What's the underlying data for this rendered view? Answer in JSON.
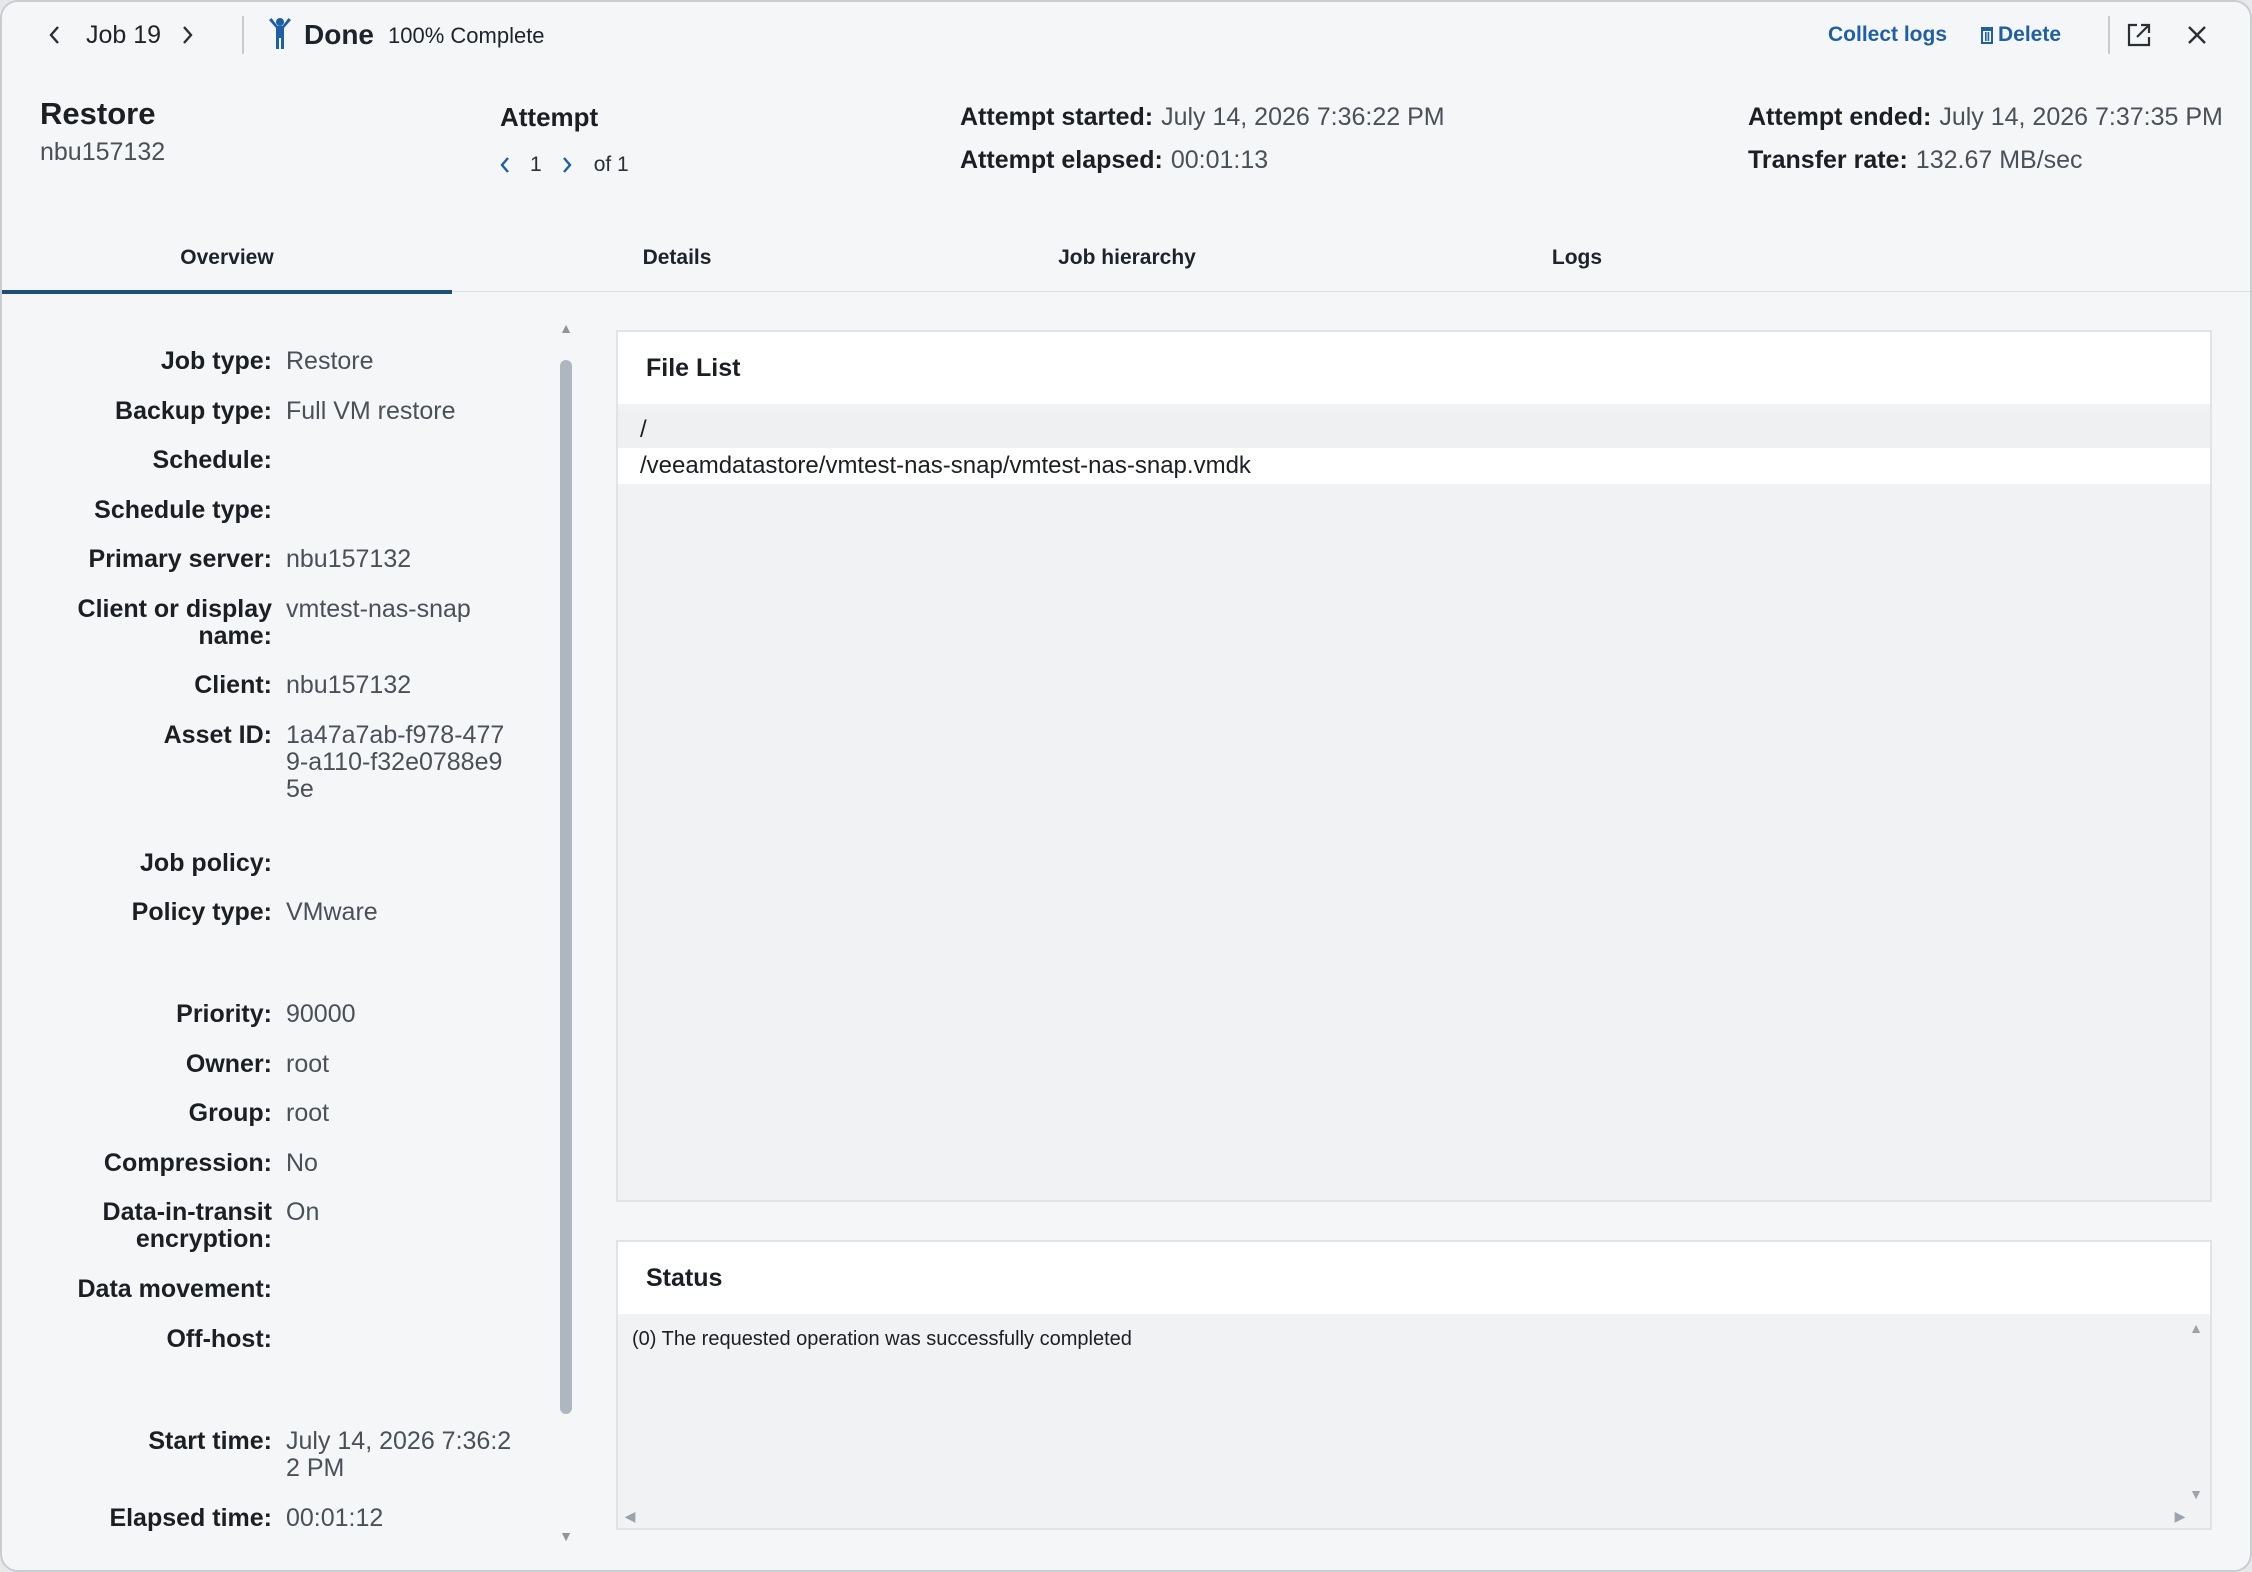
{
  "topbar": {
    "job_label": "Job 19",
    "status_label": "Done",
    "complete_label": "100% Complete",
    "collect_logs": "Collect logs",
    "delete": "Delete"
  },
  "header": {
    "title": "Restore",
    "subtitle": "nbu157132",
    "attempt_title": "Attempt",
    "attempt_current": "1",
    "attempt_of": "of 1",
    "attempt_started_label": "Attempt started:",
    "attempt_started_value": "July 14, 2026 7:36:22 PM",
    "attempt_elapsed_label": "Attempt elapsed:",
    "attempt_elapsed_value": "00:01:13",
    "attempt_ended_label": "Attempt ended:",
    "attempt_ended_value": "July 14, 2026 7:37:35 PM",
    "transfer_rate_label": "Transfer rate:",
    "transfer_rate_value": "132.67 MB/sec"
  },
  "tabs": [
    "Overview",
    "Details",
    "Job hierarchy",
    "Logs"
  ],
  "fields": [
    {
      "label": "Job type:",
      "value": "Restore"
    },
    {
      "label": "Backup type:",
      "value": "Full VM restore"
    },
    {
      "label": "Schedule:",
      "value": ""
    },
    {
      "label": "Schedule type:",
      "value": ""
    },
    {
      "label": "Primary server:",
      "value": "nbu157132"
    },
    {
      "label": "Client or display name:",
      "value": "vmtest-nas-snap"
    },
    {
      "label": "Client:",
      "value": "nbu157132"
    },
    {
      "label": "Asset ID:",
      "value": "1a47a7ab-f978-4779-a110-f32e0788e95e"
    },
    {
      "label": "Job policy:",
      "value": ""
    },
    {
      "label": "Policy type:",
      "value": "VMware"
    },
    {
      "label": "Priority:",
      "value": "90000"
    },
    {
      "label": "Owner:",
      "value": "root"
    },
    {
      "label": "Group:",
      "value": "root"
    },
    {
      "label": "Compression:",
      "value": "No"
    },
    {
      "label": "Data-in-transit encryption:",
      "value": "On"
    },
    {
      "label": "Data movement:",
      "value": ""
    },
    {
      "label": "Off-host:",
      "value": ""
    },
    {
      "label": "Start time:",
      "value": "July 14, 2026 7:36:22 PM"
    },
    {
      "label": "Elapsed time:",
      "value": "00:01:12"
    }
  ],
  "file_list": {
    "title": "File List",
    "files": [
      "/",
      "/veeamdatastore/vmtest-nas-snap/vmtest-nas-snap.vmdk"
    ]
  },
  "status": {
    "title": "Status",
    "message": "(0) The requested operation was successfully completed"
  }
}
